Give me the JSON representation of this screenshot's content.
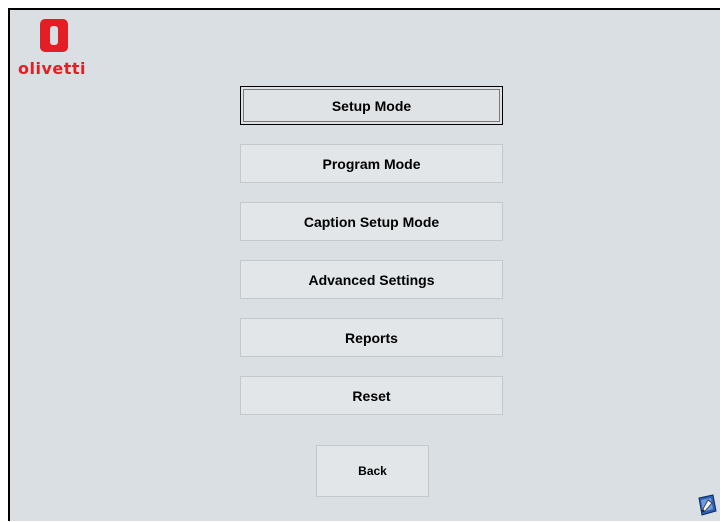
{
  "brand": {
    "logo_text": "olivetti",
    "color": "#e31e24"
  },
  "menu": {
    "items": [
      {
        "label": "Setup Mode",
        "focused": true
      },
      {
        "label": "Program Mode",
        "focused": false
      },
      {
        "label": "Caption Setup Mode",
        "focused": false
      },
      {
        "label": "Advanced Settings",
        "focused": false
      },
      {
        "label": "Reports",
        "focused": false
      },
      {
        "label": "Reset",
        "focused": false
      }
    ]
  },
  "back_button": {
    "label": "Back"
  },
  "icons": {
    "help": "help-icon"
  },
  "colors": {
    "background": "#d9dfe2",
    "button": "#e2e6e8"
  }
}
